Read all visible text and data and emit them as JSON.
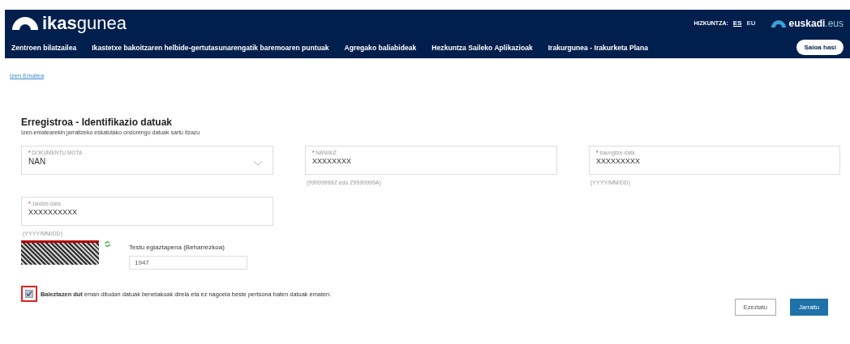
{
  "header": {
    "logo": {
      "bold": "ikas",
      "light": "gunea"
    },
    "language_label": "HIZKUNTZA:",
    "languages": [
      {
        "label": "ES",
        "selected": true
      },
      {
        "label": "EU",
        "selected": false
      }
    ],
    "brand": {
      "bold": "euskadi",
      "light": ".eus"
    },
    "nav": [
      "Zentroen bilatzailea",
      "Ikastetxe bakoitzaren helbide-gertutasunarengatik baremoaren puntuak",
      "Agregako baliabideak",
      "Hezkuntza Saileko Aplikazioak",
      "Irakurgunea - Irakurketa Plana"
    ],
    "login_button": "Saioa hasi"
  },
  "breadcrumb": "Izen Ematea",
  "form": {
    "title": "Erregistroa - Identifikazio datuak",
    "subtitle": "Izen-ematearekin jarraitzeko eskatutako ondorengo datuak sartu itzazu",
    "fields": [
      {
        "kind": "select",
        "required_mark": "*",
        "label": "DOKUMENTU MOTA",
        "value": "NAN"
      },
      {
        "kind": "text",
        "required_mark": "*",
        "label": "NAN/AIZ",
        "value": "XXXXXXXX",
        "hint": "(99999999Z edo Z9999999A)"
      },
      {
        "kind": "text",
        "required_mark": "*",
        "label": "Iraungitze-data",
        "value": "XXXXXXXXX",
        "hint": "(YYYY/MM/DD)"
      },
      {
        "kind": "text",
        "required_mark": "*",
        "label": "Jaiotze-data",
        "value": "XXXXXXXXXX",
        "hint": "(YYYY/MM/DD)"
      }
    ],
    "captcha": {
      "label": "Testu egiaztapena (Beharrezkoa)",
      "value": "1947"
    },
    "consent": {
      "checked": true,
      "text": "**Baieztazen dut** eman ditudan datuak benetakoak direla eta ez nagoela beste pertsona baten datuak ematen."
    },
    "buttons": [
      {
        "kind": "secondary",
        "label": "Ezeztatu"
      },
      {
        "kind": "primary",
        "label": "Jarraitu"
      }
    ]
  }
}
